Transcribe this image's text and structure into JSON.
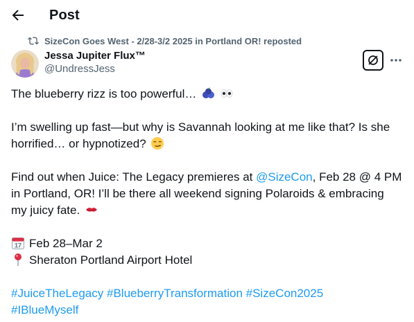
{
  "header": {
    "title": "Post"
  },
  "repost": {
    "text": "SizeCon Goes West - 2/28-3/2 2025 in Portland OR! reposted"
  },
  "author": {
    "name": "Jessa Jupiter Flux™",
    "handle": "@UndressJess"
  },
  "post": {
    "p1": "The blueberry rizz is too powerful…",
    "p2_l1": "I’m swelling up fast—but why is Savannah looking at me like that? Is she",
    "p2_l2": "horrified… or hypnotized?",
    "p3_l1_pre": "Find out when Juice: The Legacy premieres at ",
    "p3_mention": "@SizeCon",
    "p3_l1_post": ", Feb 28 @ 4 PM",
    "p3_l2": "in Portland, OR! I’ll be there all weekend signing Polaroids & embracing",
    "p3_l3": "my juicy fate.",
    "date_line": "Feb 28–Mar 2",
    "calendar_day": "17",
    "location_line": "Sheraton Portland Airport Hotel",
    "hashtags_l1": [
      "#JuiceTheLegacy",
      "#BlueberryTransformation",
      "#SizeCon2025"
    ],
    "hashtags_l2": [
      "#IBlueMyself"
    ]
  },
  "icons": {
    "back": "arrow-left-icon",
    "repost": "repost-icon",
    "grok": "grok-icon",
    "more": "more-icon",
    "blueberry": "blueberry-emoji",
    "eyes": "eyes-emoji",
    "smirk": "smirk-emoji",
    "lips": "kiss-mark-emoji",
    "calendar": "calendar-emoji",
    "pin": "round-pushpin-emoji"
  },
  "colors": {
    "text": "#0f1419",
    "secondary": "#536471",
    "link": "#1d9bf0"
  }
}
